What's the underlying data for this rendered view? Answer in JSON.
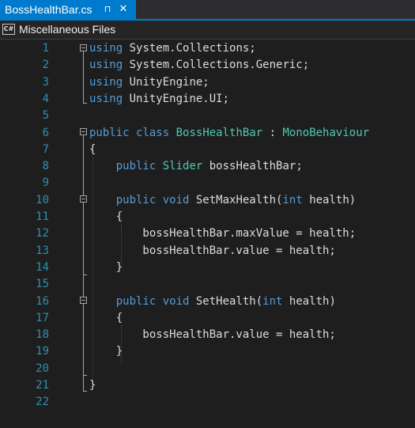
{
  "tab": {
    "title": "BossHealthBar.cs",
    "pin": "⊓",
    "close": "✕"
  },
  "nav": {
    "icon_text": "C#",
    "label": "Miscellaneous Files"
  },
  "colors": {
    "keyword": "#569cd6",
    "type": "#4ec9b0",
    "plain": "#dcdcdc",
    "line_number": "#2b91af",
    "accent": "#007acc"
  },
  "lines": [
    [
      [
        "kw",
        "using"
      ],
      [
        "pl",
        " System.Collections;"
      ]
    ],
    [
      [
        "kw",
        "using"
      ],
      [
        "pl",
        " System.Collections.Generic;"
      ]
    ],
    [
      [
        "kw",
        "using"
      ],
      [
        "pl",
        " UnityEngine;"
      ]
    ],
    [
      [
        "kw",
        "using"
      ],
      [
        "pl",
        " UnityEngine.UI;"
      ]
    ],
    [],
    [
      [
        "kw",
        "public"
      ],
      [
        "pl",
        " "
      ],
      [
        "kw",
        "class"
      ],
      [
        "pl",
        " "
      ],
      [
        "ty",
        "BossHealthBar"
      ],
      [
        "pl",
        " : "
      ],
      [
        "ty",
        "MonoBehaviour"
      ]
    ],
    [
      [
        "pl",
        "{"
      ]
    ],
    [
      [
        "pl",
        "    "
      ],
      [
        "kw",
        "public"
      ],
      [
        "pl",
        " "
      ],
      [
        "ty",
        "Slider"
      ],
      [
        "pl",
        " bossHealthBar;"
      ]
    ],
    [],
    [
      [
        "pl",
        "    "
      ],
      [
        "kw",
        "public"
      ],
      [
        "pl",
        " "
      ],
      [
        "kw",
        "void"
      ],
      [
        "pl",
        " SetMaxHealth("
      ],
      [
        "kw",
        "int"
      ],
      [
        "pl",
        " health)"
      ]
    ],
    [
      [
        "pl",
        "    {"
      ]
    ],
    [
      [
        "pl",
        "        bossHealthBar.maxValue = health;"
      ]
    ],
    [
      [
        "pl",
        "        bossHealthBar.value = health;"
      ]
    ],
    [
      [
        "pl",
        "    }"
      ]
    ],
    [],
    [
      [
        "pl",
        "    "
      ],
      [
        "kw",
        "public"
      ],
      [
        "pl",
        " "
      ],
      [
        "kw",
        "void"
      ],
      [
        "pl",
        " SetHealth("
      ],
      [
        "kw",
        "int"
      ],
      [
        "pl",
        " health)"
      ]
    ],
    [
      [
        "pl",
        "    {"
      ]
    ],
    [
      [
        "pl",
        "        bossHealthBar.value = health;"
      ]
    ],
    [
      [
        "pl",
        "    }"
      ]
    ],
    [],
    [
      [
        "pl",
        "}"
      ]
    ],
    []
  ]
}
